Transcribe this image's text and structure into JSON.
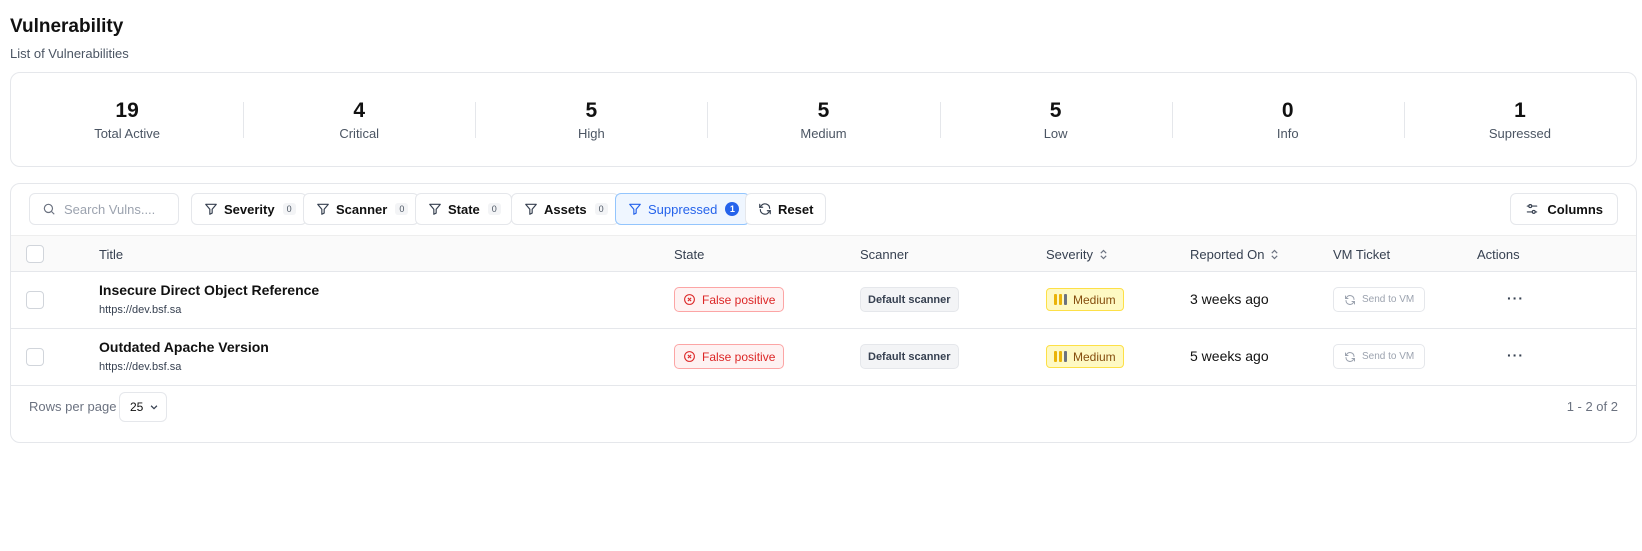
{
  "header": {
    "title": "Vulnerability",
    "subtitle": "List of Vulnerabilities"
  },
  "stats": [
    {
      "value": "19",
      "label": "Total Active"
    },
    {
      "value": "4",
      "label": "Critical"
    },
    {
      "value": "5",
      "label": "High"
    },
    {
      "value": "5",
      "label": "Medium"
    },
    {
      "value": "5",
      "label": "Low"
    },
    {
      "value": "0",
      "label": "Info"
    },
    {
      "value": "1",
      "label": "Supressed"
    }
  ],
  "toolbar": {
    "search_placeholder": "Search Vulns....",
    "filters": [
      {
        "label": "Severity",
        "count": "0"
      },
      {
        "label": "Scanner",
        "count": "0"
      },
      {
        "label": "State",
        "count": "0"
      },
      {
        "label": "Assets",
        "count": "0"
      },
      {
        "label": "Suppressed",
        "count": "1"
      }
    ],
    "reset_label": "Reset",
    "columns_label": "Columns"
  },
  "table": {
    "headers": {
      "title": "Title",
      "state": "State",
      "scanner": "Scanner",
      "severity": "Severity",
      "reported_on": "Reported On",
      "vm_ticket": "VM Ticket",
      "actions": "Actions"
    },
    "rows": [
      {
        "title": "Insecure Direct Object Reference",
        "host": "https://dev.bsf.sa",
        "state": "False positive",
        "scanner": "Default scanner",
        "severity": "Medium",
        "reported": "3 weeks ago",
        "vm_action": "Send to VM",
        "actions": "···"
      },
      {
        "title": "Outdated Apache Version",
        "host": "https://dev.bsf.sa",
        "state": "False positive",
        "scanner": "Default scanner",
        "severity": "Medium",
        "reported": "5 weeks ago",
        "vm_action": "Send to VM",
        "actions": "···"
      }
    ]
  },
  "footer": {
    "rows_per_page_label": "Rows per page",
    "rows_per_page_value": "25",
    "pagination": "1 - 2 of 2"
  },
  "colors": {
    "accent": "#2563eb",
    "danger": "#dc2626",
    "warning_bg": "#fef9c3",
    "warning": "#eab308"
  }
}
